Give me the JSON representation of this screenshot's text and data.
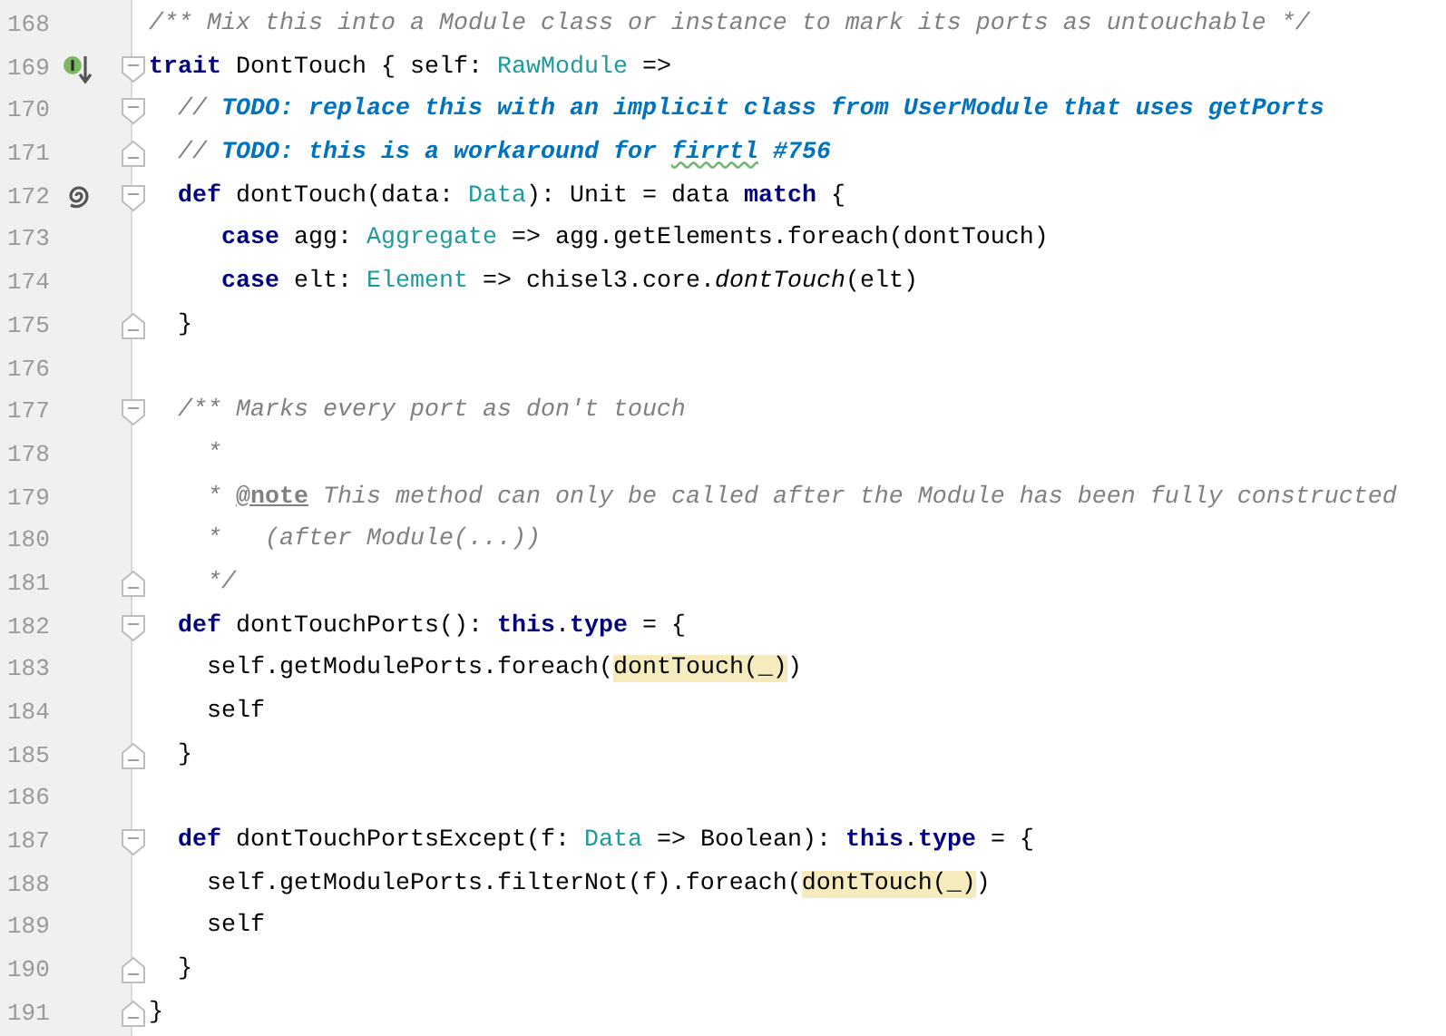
{
  "lines": [
    {
      "number": "168",
      "fold_start": false,
      "fold_end": false,
      "implemented": false,
      "recursive": false,
      "tokens": [
        {
          "text": "/** Mix this into a Module class or instance to mark its ports as untouchable */",
          "kind": "doc"
        }
      ]
    },
    {
      "number": "169",
      "fold_start": true,
      "fold_end": false,
      "implemented": true,
      "recursive": false,
      "tokens": [
        {
          "text": "trait",
          "kind": "keyword"
        },
        {
          "text": " DontTouch { self: ",
          "kind": "plain"
        },
        {
          "text": "RawModule",
          "kind": "type"
        },
        {
          "text": " =>",
          "kind": "plain"
        }
      ]
    },
    {
      "number": "170",
      "fold_start": true,
      "fold_end": false,
      "implemented": false,
      "recursive": false,
      "tokens": [
        {
          "text": "  // ",
          "kind": "comment"
        },
        {
          "text": "TODO: replace this with an implicit class from UserModule that uses getPorts",
          "kind": "todo"
        }
      ]
    },
    {
      "number": "171",
      "fold_start": false,
      "fold_end": true,
      "implemented": false,
      "recursive": false,
      "tokens": [
        {
          "text": "  // ",
          "kind": "comment"
        },
        {
          "text": "TODO: this is a workaround for ",
          "kind": "todo"
        },
        {
          "text": "firrtl",
          "kind": "todo_typo"
        },
        {
          "text": " #756",
          "kind": "todo"
        }
      ]
    },
    {
      "number": "172",
      "fold_start": true,
      "fold_end": false,
      "implemented": false,
      "recursive": true,
      "tokens": [
        {
          "text": "  def",
          "kind": "keyword"
        },
        {
          "text": " dontTouch(data: ",
          "kind": "plain"
        },
        {
          "text": "Data",
          "kind": "type"
        },
        {
          "text": "): Unit = data ",
          "kind": "plain"
        },
        {
          "text": "match",
          "kind": "keyword"
        },
        {
          "text": " {",
          "kind": "plain"
        }
      ]
    },
    {
      "number": "173",
      "fold_start": false,
      "fold_end": false,
      "implemented": false,
      "recursive": false,
      "tokens": [
        {
          "text": "     case",
          "kind": "keyword"
        },
        {
          "text": " agg: ",
          "kind": "plain"
        },
        {
          "text": "Aggregate",
          "kind": "type"
        },
        {
          "text": " => agg.getElements.foreach(dontTouch)",
          "kind": "plain"
        }
      ]
    },
    {
      "number": "174",
      "fold_start": false,
      "fold_end": false,
      "implemented": false,
      "recursive": false,
      "tokens": [
        {
          "text": "     case",
          "kind": "keyword"
        },
        {
          "text": " elt: ",
          "kind": "plain"
        },
        {
          "text": "Element",
          "kind": "type"
        },
        {
          "text": " => chisel3.core.",
          "kind": "plain"
        },
        {
          "text": "dontTouch",
          "kind": "italic"
        },
        {
          "text": "(elt)",
          "kind": "plain"
        }
      ]
    },
    {
      "number": "175",
      "fold_start": false,
      "fold_end": true,
      "implemented": false,
      "recursive": false,
      "tokens": [
        {
          "text": "  }",
          "kind": "plain"
        }
      ]
    },
    {
      "number": "176",
      "fold_start": false,
      "fold_end": false,
      "implemented": false,
      "recursive": false
    },
    {
      "number": "177",
      "fold_start": true,
      "fold_end": false,
      "implemented": false,
      "recursive": false,
      "tokens": [
        {
          "text": "  /** Marks every port as don't touch",
          "kind": "doc"
        }
      ]
    },
    {
      "number": "178",
      "fold_start": false,
      "fold_end": false,
      "implemented": false,
      "recursive": false,
      "tokens": [
        {
          "text": "    *",
          "kind": "doc"
        }
      ]
    },
    {
      "number": "179",
      "fold_start": false,
      "fold_end": false,
      "implemented": false,
      "recursive": false,
      "tokens": [
        {
          "text": "    * ",
          "kind": "doc"
        },
        {
          "text": "@note",
          "kind": "tag"
        },
        {
          "text": " This method can only be called after the Module has been fully constructed",
          "kind": "doc"
        }
      ]
    },
    {
      "number": "180",
      "fold_start": false,
      "fold_end": false,
      "implemented": false,
      "recursive": false,
      "tokens": [
        {
          "text": "    *   (after Module(...))",
          "kind": "doc"
        }
      ]
    },
    {
      "number": "181",
      "fold_start": false,
      "fold_end": true,
      "implemented": false,
      "recursive": false,
      "tokens": [
        {
          "text": "    */",
          "kind": "doc"
        }
      ]
    },
    {
      "number": "182",
      "fold_start": true,
      "fold_end": false,
      "implemented": false,
      "recursive": false,
      "tokens": [
        {
          "text": "  def",
          "kind": "keyword"
        },
        {
          "text": " dontTouchPorts(): ",
          "kind": "plain"
        },
        {
          "text": "this",
          "kind": "keyword"
        },
        {
          "text": ".",
          "kind": "plain"
        },
        {
          "text": "type",
          "kind": "keyword"
        },
        {
          "text": " = {",
          "kind": "plain"
        }
      ]
    },
    {
      "number": "183",
      "fold_start": false,
      "fold_end": false,
      "implemented": false,
      "recursive": false,
      "tokens": [
        {
          "text": "    self.getModulePorts.foreach(",
          "kind": "plain"
        },
        {
          "text": "dontTouch(_)",
          "kind": "highlight"
        },
        {
          "text": ")",
          "kind": "plain"
        }
      ]
    },
    {
      "number": "184",
      "fold_start": false,
      "fold_end": false,
      "implemented": false,
      "recursive": false,
      "tokens": [
        {
          "text": "    self",
          "kind": "plain"
        }
      ]
    },
    {
      "number": "185",
      "fold_start": false,
      "fold_end": true,
      "implemented": false,
      "recursive": false,
      "tokens": [
        {
          "text": "  }",
          "kind": "plain"
        }
      ]
    },
    {
      "number": "186",
      "fold_start": false,
      "fold_end": false,
      "implemented": false,
      "recursive": false
    },
    {
      "number": "187",
      "fold_start": true,
      "fold_end": false,
      "implemented": false,
      "recursive": false,
      "tokens": [
        {
          "text": "  def",
          "kind": "keyword"
        },
        {
          "text": " dontTouchPortsExcept(f: ",
          "kind": "plain"
        },
        {
          "text": "Data",
          "kind": "type"
        },
        {
          "text": " => Boolean): ",
          "kind": "plain"
        },
        {
          "text": "this",
          "kind": "keyword"
        },
        {
          "text": ".",
          "kind": "plain"
        },
        {
          "text": "type",
          "kind": "keyword"
        },
        {
          "text": " = {",
          "kind": "plain"
        }
      ]
    },
    {
      "number": "188",
      "fold_start": false,
      "fold_end": false,
      "implemented": false,
      "recursive": false,
      "tokens": [
        {
          "text": "    self.getModulePorts.filterNot(f).foreach(",
          "kind": "plain"
        },
        {
          "text": "dontTouch(_)",
          "kind": "highlight"
        },
        {
          "text": ")",
          "kind": "plain"
        }
      ]
    },
    {
      "number": "189",
      "fold_start": false,
      "fold_end": false,
      "implemented": false,
      "recursive": false,
      "tokens": [
        {
          "text": "    self",
          "kind": "plain"
        }
      ]
    },
    {
      "number": "190",
      "fold_start": false,
      "fold_end": true,
      "implemented": false,
      "recursive": false,
      "tokens": [
        {
          "text": "  }",
          "kind": "plain"
        }
      ]
    },
    {
      "number": "191",
      "fold_start": false,
      "fold_end": true,
      "implemented": false,
      "recursive": false,
      "tokens": [
        {
          "text": "}",
          "kind": "plain"
        }
      ]
    }
  ]
}
